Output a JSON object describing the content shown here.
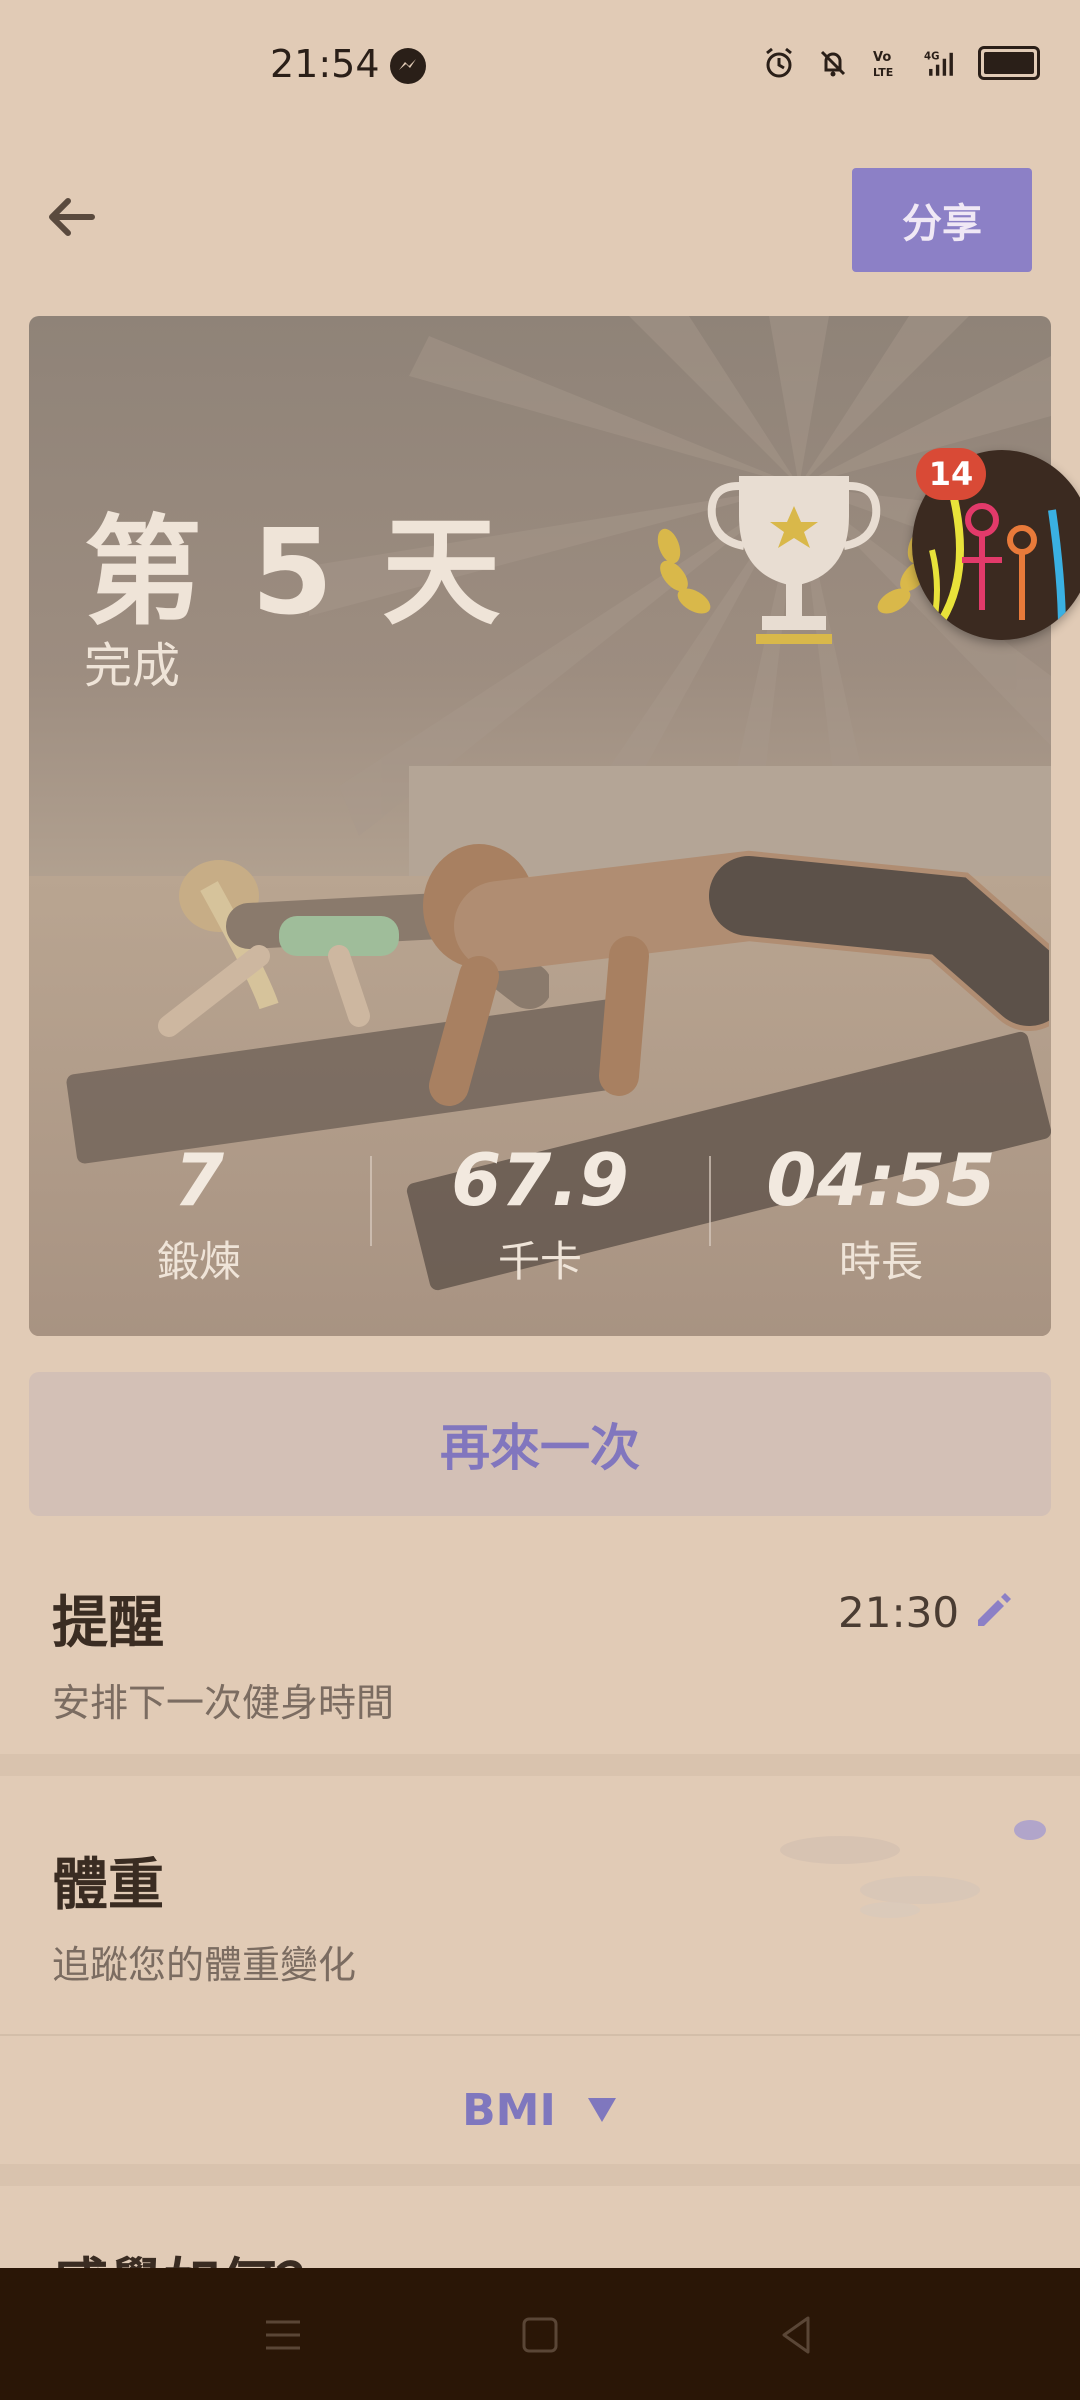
{
  "status_bar": {
    "time": "21:54",
    "icons": [
      "messenger-icon",
      "alarm-icon",
      "mute-icon",
      "volte-icon",
      "signal-4g-icon",
      "battery-icon"
    ]
  },
  "header": {
    "back_icon": "arrow-left-icon",
    "share_label": "分享"
  },
  "hero": {
    "day_title": "第 5 天",
    "day_subtitle": "完成",
    "stats": [
      {
        "value": "7",
        "label": "鍛煉"
      },
      {
        "value": "67.9",
        "label": "千卡"
      },
      {
        "value": "04:55",
        "label": "時長"
      }
    ]
  },
  "chat_head": {
    "badge_count": "14"
  },
  "again_label": "再來一次",
  "reminder": {
    "title": "提醒",
    "subtitle": "安排下一次健身時間",
    "time": "21:30",
    "edit_icon": "pencil-icon"
  },
  "weight": {
    "title": "體重",
    "subtitle": "追蹤您的體重變化"
  },
  "bmi": {
    "label": "BMI"
  },
  "next_section_title": "感覺如何？",
  "colors": {
    "background": "#e1cbb6",
    "accent": "#8c80c6",
    "navbar": "#2a1606",
    "badge": "#d94a36"
  }
}
